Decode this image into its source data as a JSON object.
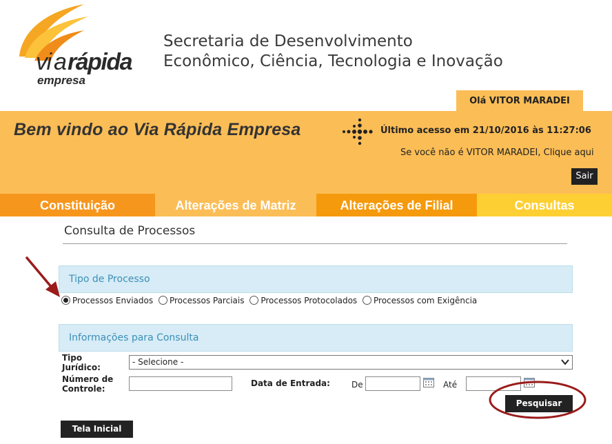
{
  "header": {
    "logo": {
      "brand": "viarápida",
      "sub": "empresa"
    },
    "org_title_line1": "Secretaria de Desenvolvimento",
    "org_title_line2": "Econômico, Ciência, Tecnologia e Inovação",
    "greeting": "Olá VITOR MARADEI"
  },
  "banner": {
    "welcome": "Bem vindo ao Via Rápida Empresa",
    "last_access": "Último acesso em 21/10/2016 às 11:27:06",
    "not_you": "Se você não é VITOR MARADEI, Clique aqui",
    "logout": "Sair"
  },
  "nav": [
    "Constituição",
    "Alterações de Matriz",
    "Alterações de Filial",
    "Consultas"
  ],
  "page": {
    "heading": "Consulta de Processos",
    "section_tipo": "Tipo de Processo",
    "radios": [
      {
        "label": "Processos Enviados",
        "checked": true
      },
      {
        "label": "Processos Parciais",
        "checked": false
      },
      {
        "label": "Processos Protocolados",
        "checked": false
      },
      {
        "label": "Processos com Exigência",
        "checked": false
      }
    ],
    "section_info": "Informações para Consulta",
    "form": {
      "tipo_label_1": "Tipo",
      "tipo_label_2": "Jurídico:",
      "tipo_value": "- Selecione -",
      "numero_label_1": "Número de",
      "numero_label_2": "Controle:",
      "numero_value": "",
      "data_label": "Data de Entrada:",
      "de_label": "De",
      "de_value": "",
      "ate_label": "Até",
      "ate_value": ""
    },
    "search_button": "Pesquisar",
    "home_button": "Tela Inicial"
  },
  "colors": {
    "banner": "#fbbd56",
    "nav_constituicao": "#f7961d",
    "nav_matriz": "#fbbd56",
    "nav_filial": "#f59a0c",
    "nav_consultas": "#fecf33",
    "section_bg": "#d7ecf6",
    "section_text": "#3b8fb8",
    "annotation": "#9b1b1b"
  }
}
